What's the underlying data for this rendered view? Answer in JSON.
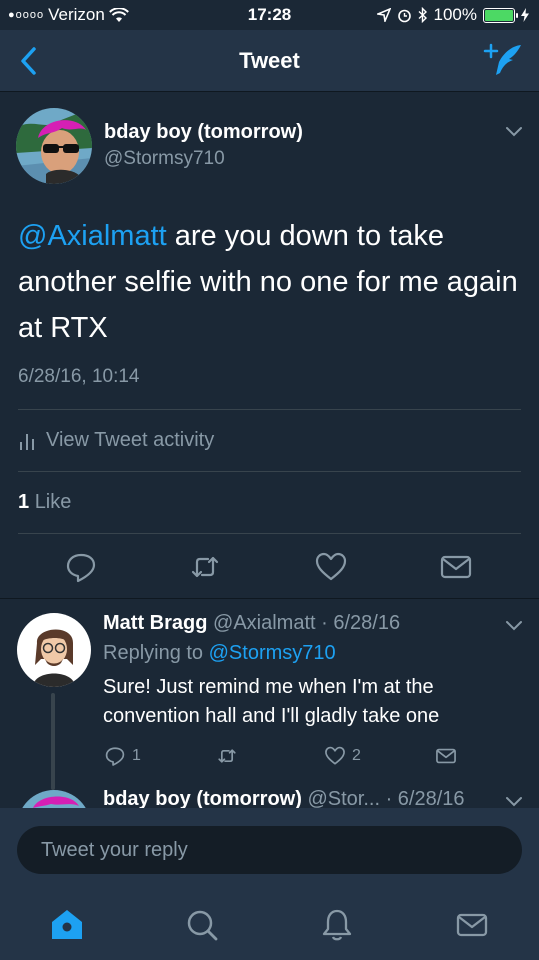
{
  "status_bar": {
    "signal": "●oooo",
    "carrier": "Verizon",
    "time": "17:28",
    "battery": "100%"
  },
  "nav": {
    "title": "Tweet",
    "back_icon": "chevron-left-icon",
    "compose_icon": "compose-tweet-icon"
  },
  "tweet": {
    "author_name": "bday boy (tomorrow)",
    "author_handle": "@Stormsy710",
    "mention": "@Axialmatt",
    "text": " are you down to take another selfie with no one for me again at RTX",
    "date": "6/28/16, 10:14",
    "activity_label": "View Tweet activity",
    "like_count": "1",
    "like_label": "Like"
  },
  "reply": {
    "author_name": "Matt Bragg",
    "author_handle": "@Axialmatt",
    "date": "· 6/28/16",
    "replying_to_label": "Replying to",
    "replying_to_handle": "@Stormsy710",
    "text": "Sure! Just remind me when I'm at the convention hall and I'll gladly take one",
    "reply_count": "1",
    "like_count": "2"
  },
  "next_tweet": {
    "author_name": "bday boy (tomorrow)",
    "author_handle": "@Stor...",
    "date": "· 6/28/16"
  },
  "reply_bar": {
    "placeholder": "Tweet your reply"
  },
  "tabs": [
    "home-icon",
    "search-icon",
    "notifications-icon",
    "messages-icon"
  ],
  "colors": {
    "background": "#1b2836",
    "bar": "#243447",
    "accent": "#1da1f2",
    "muted": "#8899a6",
    "battery": "#4cd964"
  }
}
